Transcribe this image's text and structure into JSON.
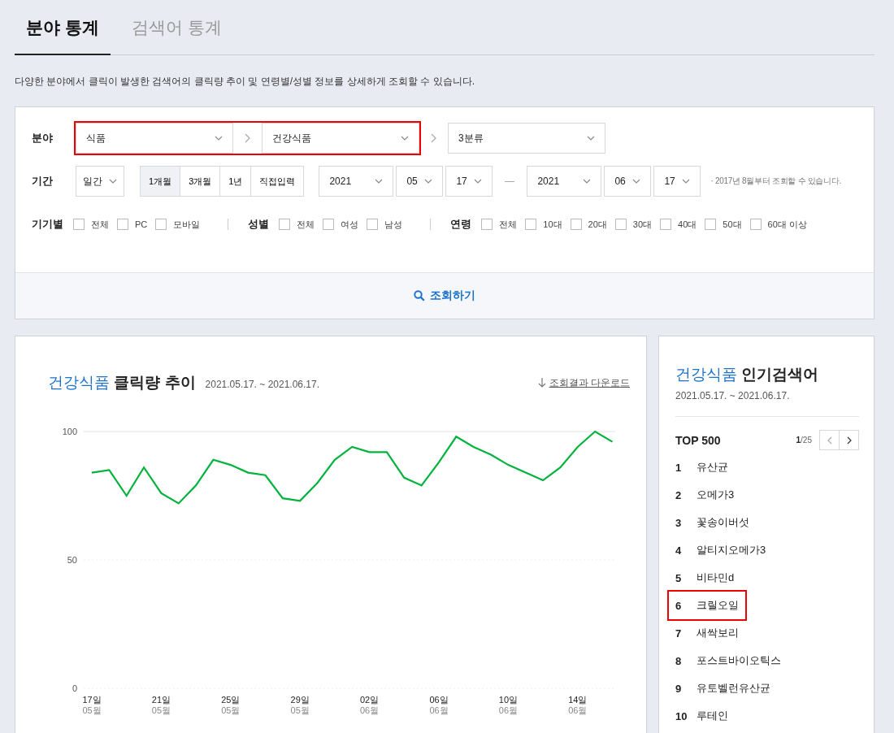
{
  "tabs": [
    {
      "label": "분야 통계",
      "selected": true
    },
    {
      "label": "검색어 통계",
      "selected": false
    }
  ],
  "description": "다양한 분야에서 클릭이 발생한 검색어의 클릭량 추이 및 연령별/성별 정보를 상세하게 조회할 수 있습니다.",
  "filters": {
    "category": {
      "label": "분야",
      "selects": [
        {
          "value": "식품",
          "highlighted": true
        },
        {
          "value": "건강식품",
          "highlighted": true
        },
        {
          "value": "3분류",
          "highlighted": false
        }
      ]
    },
    "period": {
      "label": "기간",
      "unit": "일간",
      "ranges": [
        {
          "label": "1개월",
          "selected": true
        },
        {
          "label": "3개월",
          "selected": false
        },
        {
          "label": "1년",
          "selected": false
        },
        {
          "label": "직접입력",
          "selected": false
        }
      ],
      "start": [
        "2021",
        "05",
        "17"
      ],
      "end": [
        "2021",
        "06",
        "17"
      ],
      "note": "· 2017년 8월부터 조회할 수 있습니다."
    },
    "groups": [
      {
        "label": "기기별",
        "options": [
          {
            "label": "전체",
            "checked": false
          },
          {
            "label": "PC",
            "checked": false
          },
          {
            "label": "모바일",
            "checked": false
          }
        ]
      },
      {
        "label": "성별",
        "options": [
          {
            "label": "전체",
            "checked": false
          },
          {
            "label": "여성",
            "checked": false
          },
          {
            "label": "남성",
            "checked": false
          }
        ]
      },
      {
        "label": "연령",
        "options": [
          {
            "label": "전체",
            "checked": false
          },
          {
            "label": "10대",
            "checked": false
          },
          {
            "label": "20대",
            "checked": false
          },
          {
            "label": "30대",
            "checked": false
          },
          {
            "label": "40대",
            "checked": false
          },
          {
            "label": "50대",
            "checked": false
          },
          {
            "label": "60대 이상",
            "checked": false
          }
        ]
      }
    ],
    "search_button": "조회하기"
  },
  "trend": {
    "title_category": "건강식품",
    "title": "클릭량 추이",
    "date_range": "2021.05.17. ~ 2021.06.17.",
    "download": "조회결과 다운로드",
    "chart_data": {
      "type": "line",
      "categories": [
        "17일 05월",
        null,
        null,
        null,
        "21일 05월",
        null,
        null,
        null,
        "25일 05월",
        null,
        null,
        null,
        "29일 05월",
        null,
        null,
        null,
        "02일 06월",
        null,
        null,
        null,
        "06일 06월",
        null,
        null,
        null,
        "10일 06월",
        null,
        null,
        null,
        "14일 06월",
        null,
        null
      ],
      "ylim": [
        0,
        100
      ],
      "yticks": [
        0,
        50,
        100
      ],
      "series": [
        {
          "color": "#00b33c",
          "values": [
            84,
            85,
            75,
            86,
            76,
            72,
            79,
            89,
            87,
            84,
            83,
            74,
            73,
            80,
            89,
            94,
            92,
            92,
            82,
            79,
            88,
            98,
            94,
            91,
            87,
            84,
            81,
            86,
            94,
            100,
            96
          ]
        }
      ]
    }
  },
  "popular": {
    "title_category": "건강식품",
    "title": "인기검색어",
    "date_range": "2021.05.17. ~ 2021.06.17.",
    "top_label": "TOP 500",
    "page": "1",
    "pages": "/25",
    "items": [
      {
        "rank": "1",
        "term": "유산균",
        "highlighted": false
      },
      {
        "rank": "2",
        "term": "오메가3",
        "highlighted": false
      },
      {
        "rank": "3",
        "term": "꽃송이버섯",
        "highlighted": false
      },
      {
        "rank": "4",
        "term": "알티지오메가3",
        "highlighted": false
      },
      {
        "rank": "5",
        "term": "비타민d",
        "highlighted": false
      },
      {
        "rank": "6",
        "term": "크릴오일",
        "highlighted": true
      },
      {
        "rank": "7",
        "term": "새싹보리",
        "highlighted": false
      },
      {
        "rank": "8",
        "term": "포스트바이오틱스",
        "highlighted": false
      },
      {
        "rank": "9",
        "term": "유토벨런유산균",
        "highlighted": false
      },
      {
        "rank": "10",
        "term": "루테인",
        "highlighted": false
      }
    ]
  }
}
